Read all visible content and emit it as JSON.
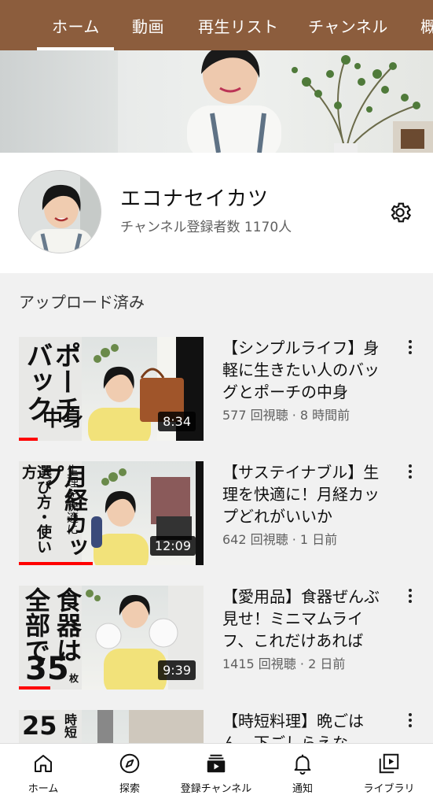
{
  "top_tabs": [
    {
      "label": "ホーム",
      "active": true
    },
    {
      "label": "動画"
    },
    {
      "label": "再生リスト"
    },
    {
      "label": "チャンネル"
    },
    {
      "label": "概"
    }
  ],
  "channel": {
    "name": "エコナセイカツ",
    "subscribers": "チャンネル登録者数 1170人"
  },
  "section_title": "アップロード済み",
  "videos": [
    {
      "title": "【シンプルライフ】身軽に生きたい人のバッグとポーチの中身",
      "meta": "577 回視聴 · 8 時間前",
      "duration": "8:34",
      "thumb_text": [
        "バック",
        "ポーチ",
        "の",
        "中身"
      ],
      "progress": 0.1
    },
    {
      "title": "【サステイナブル】生理を快適に！月経カップどれがいいか",
      "meta": "642 回視聴 · 1 日前",
      "duration": "12:09",
      "thumb_text": [
        "月経カップ",
        "生理を快適に",
        "選び方・使い方"
      ],
      "progress": 0.4
    },
    {
      "title": "【愛用品】食器ぜんぶ見せ！ミニマムライフ、これだけあれば",
      "meta": "1415 回視聴 · 2 日前",
      "duration": "9:39",
      "thumb_text": [
        "食器は",
        "全部で",
        "35",
        "枚"
      ],
      "progress": 0.17
    },
    {
      "title": "【時短料理】晩ごはん、下ごしらえな",
      "meta": "",
      "duration": "",
      "thumb_text": [
        "25",
        "時短"
      ],
      "progress": 0
    }
  ],
  "bottom_nav": [
    {
      "label": "ホーム",
      "icon": "home-icon"
    },
    {
      "label": "探索",
      "icon": "compass-icon"
    },
    {
      "label": "登録チャンネル",
      "icon": "subscriptions-icon"
    },
    {
      "label": "通知",
      "icon": "bell-icon"
    },
    {
      "label": "ライブラリ",
      "icon": "library-icon"
    }
  ],
  "colors": {
    "header_brown": "#8c5d3d",
    "progress_red": "#ff0000"
  }
}
